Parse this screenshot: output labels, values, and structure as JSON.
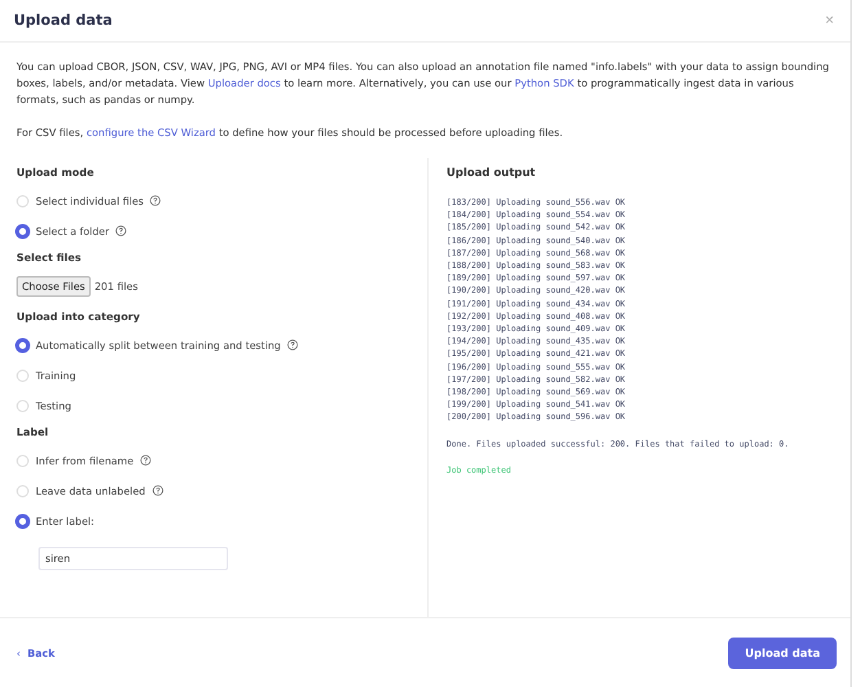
{
  "window": {
    "title": "Upload data",
    "close": "×"
  },
  "intro": [
    {
      "kind": "text",
      "text": "You can upload CBOR, JSON, CSV, WAV, JPG, PNG, AVI or MP4 files. You can also upload an annotation file named \"info.labels\" with your data to assign bounding boxes, labels, and/or metadata. View "
    },
    {
      "kind": "link",
      "text": "Uploader docs"
    },
    {
      "kind": "text",
      "text": " to learn more. Alternatively, you can use our "
    },
    {
      "kind": "link",
      "text": "Python SDK"
    },
    {
      "kind": "text",
      "text": " to programmatically ingest data in various formats, such as pandas or numpy."
    }
  ],
  "csv_note": [
    {
      "kind": "text",
      "text": "For CSV files, "
    },
    {
      "kind": "link",
      "text": "configure the CSV Wizard"
    },
    {
      "kind": "text",
      "text": " to define how your files should be processed before uploading files."
    }
  ],
  "upload_mode": {
    "heading": "Upload mode",
    "options": [
      {
        "label": "Select individual files",
        "help": true,
        "selected": false
      },
      {
        "label": "Select a folder",
        "help": true,
        "selected": true
      }
    ]
  },
  "select_files": {
    "heading": "Select files",
    "button": "Choose Files",
    "status": "201 files"
  },
  "category": {
    "heading": "Upload into category",
    "options": [
      {
        "label": "Automatically split between training and testing",
        "help": true,
        "selected": true
      },
      {
        "label": "Training",
        "help": false,
        "selected": false
      },
      {
        "label": "Testing",
        "help": false,
        "selected": false
      }
    ]
  },
  "label": {
    "heading": "Label",
    "options": [
      {
        "label": "Infer from filename",
        "help": true,
        "selected": false
      },
      {
        "label": "Leave data unlabeled",
        "help": true,
        "selected": false
      },
      {
        "label": "Enter label:",
        "help": false,
        "selected": true
      }
    ],
    "value": "siren"
  },
  "output": {
    "heading": "Upload output",
    "lines": [
      "[183/200] Uploading sound_556.wav OK",
      "[184/200] Uploading sound_554.wav OK",
      "[185/200] Uploading sound_542.wav OK",
      "[186/200] Uploading sound_540.wav OK",
      "[187/200] Uploading sound_568.wav OK",
      "[188/200] Uploading sound_583.wav OK",
      "[189/200] Uploading sound_597.wav OK",
      "[190/200] Uploading sound_420.wav OK",
      "[191/200] Uploading sound_434.wav OK",
      "[192/200] Uploading sound_408.wav OK",
      "[193/200] Uploading sound_409.wav OK",
      "[194/200] Uploading sound_435.wav OK",
      "[195/200] Uploading sound_421.wav OK",
      "[196/200] Uploading sound_555.wav OK",
      "[197/200] Uploading sound_582.wav OK",
      "[198/200] Uploading sound_569.wav OK",
      "[199/200] Uploading sound_541.wav OK",
      "[200/200] Uploading sound_596.wav OK"
    ],
    "summary": "Done. Files uploaded successful: 200. Files that failed to upload: 0.",
    "status": "Job completed"
  },
  "footer": {
    "back": "Back",
    "back_icon": "‹",
    "submit": "Upload data"
  }
}
